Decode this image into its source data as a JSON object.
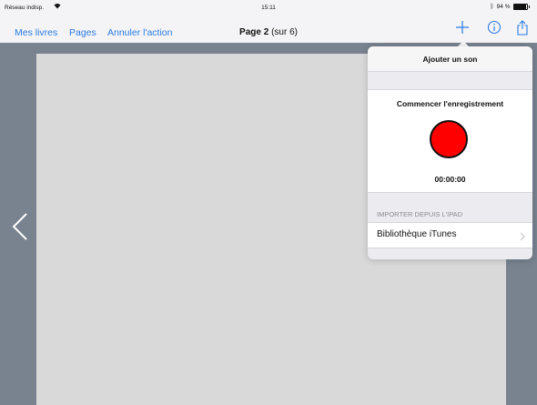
{
  "status_bar": {
    "carrier": "Réseau indisp.",
    "time": "15:11",
    "battery_text": "94 %",
    "battery_level": 0.94
  },
  "nav": {
    "my_books": "Mes livres",
    "pages": "Pages",
    "undo": "Annuler l'action",
    "title_prefix": "Page 2",
    "title_suffix": "(sur 6)",
    "add_icon": "plus-icon",
    "info_icon": "info-icon",
    "share_icon": "share-icon"
  },
  "popover": {
    "title": "Ajouter un son",
    "record_title": "Commencer l'enregistrement",
    "record_time": "00:00:00",
    "import_header": "IMPORTER DEPUIS L'IPAD",
    "itunes_label": "Bibliothèque iTunes"
  },
  "colors": {
    "accent": "#2a7be4",
    "record": "#ff0000",
    "background": "#78838f"
  }
}
